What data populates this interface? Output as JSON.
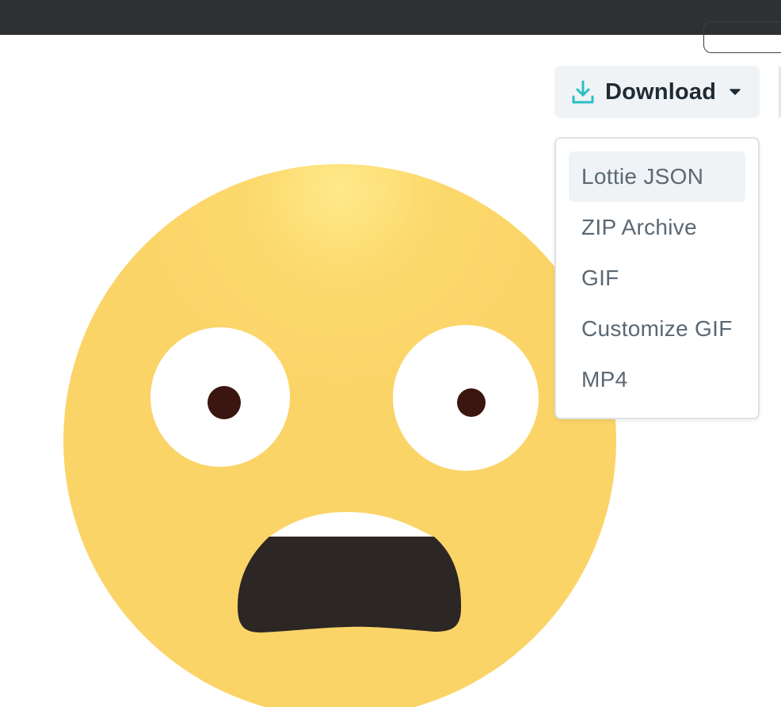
{
  "download": {
    "label": "Download",
    "icon": "download-icon",
    "caret": "caret-down-icon",
    "accent": "#2bbfc4"
  },
  "menu": {
    "items": [
      {
        "label": "Lottie JSON",
        "active": true
      },
      {
        "label": "ZIP Archive",
        "active": false
      },
      {
        "label": "GIF",
        "active": false
      },
      {
        "label": "Customize GIF",
        "active": false
      },
      {
        "label": "MP4",
        "active": false
      }
    ]
  },
  "preview": {
    "subject": "fearful-face-emoji",
    "face_color": "#fbd468",
    "mouth_color": "#2c2624",
    "pupil_color": "#3b1510"
  }
}
